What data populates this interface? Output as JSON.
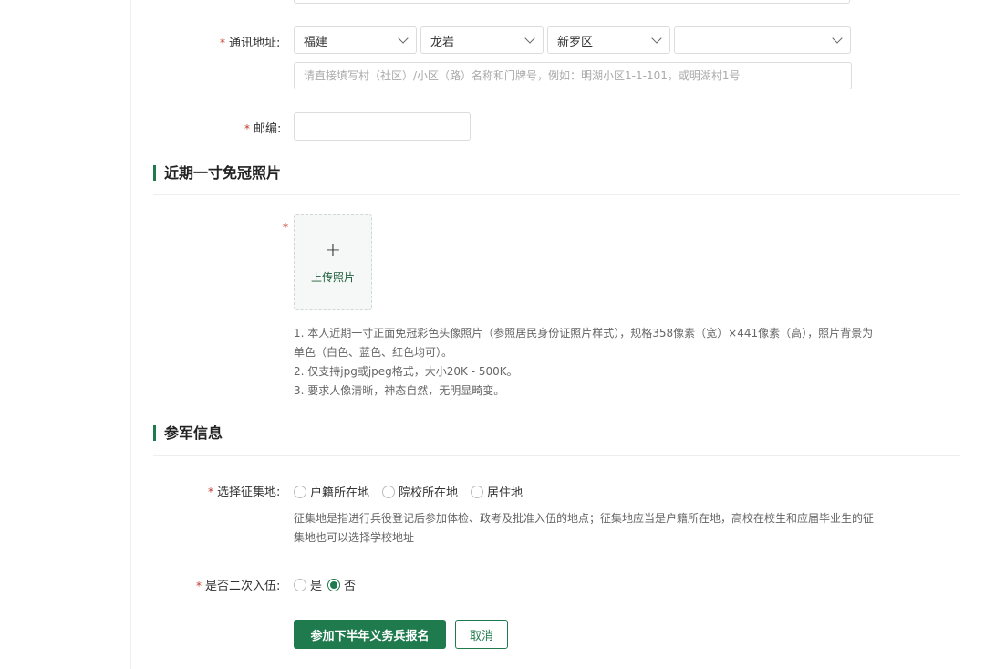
{
  "address": {
    "label": "通讯地址:",
    "province": "福建",
    "city": "龙岩",
    "district": "新罗区",
    "street": "",
    "detail_placeholder": "请直接填写村（社区）/小区（路）名称和门牌号，例如：明湖小区1-1-101，或明湖村1号"
  },
  "postcode": {
    "label": "邮编:",
    "value": ""
  },
  "photo_section": {
    "title": "近期一寸免冠照片",
    "upload_label": "上传照片",
    "notes": [
      "1. 本人近期一寸正面免冠彩色头像照片（参照居民身份证照片样式），规格358像素（宽）×441像素（高），照片背景为",
      "单色（白色、蓝色、红色均可）。",
      "2. 仅支持jpg或jpeg格式，大小20K - 500K。",
      "3. 要求人像清晰，神态自然，无明显畸变。"
    ]
  },
  "military_section": {
    "title": "参军信息",
    "recruit_place": {
      "label": "选择征集地:",
      "options": [
        "户籍所在地",
        "院校所在地",
        "居住地"
      ],
      "selected": null,
      "help": [
        "征集地是指进行兵役登记后参加体检、政考及批准入伍的地点；征集地应当是户籍所在地，高校在校生和应届毕业生的征",
        "集地也可以选择学校地址"
      ]
    },
    "second_enlist": {
      "label": "是否二次入伍:",
      "options": [
        "是",
        "否"
      ],
      "selected": "否"
    }
  },
  "actions": {
    "submit_label": "参加下半年义务兵报名",
    "cancel_label": "取消"
  },
  "colors": {
    "brand_green": "#1f7a4d",
    "required_red": "#c0392b"
  }
}
